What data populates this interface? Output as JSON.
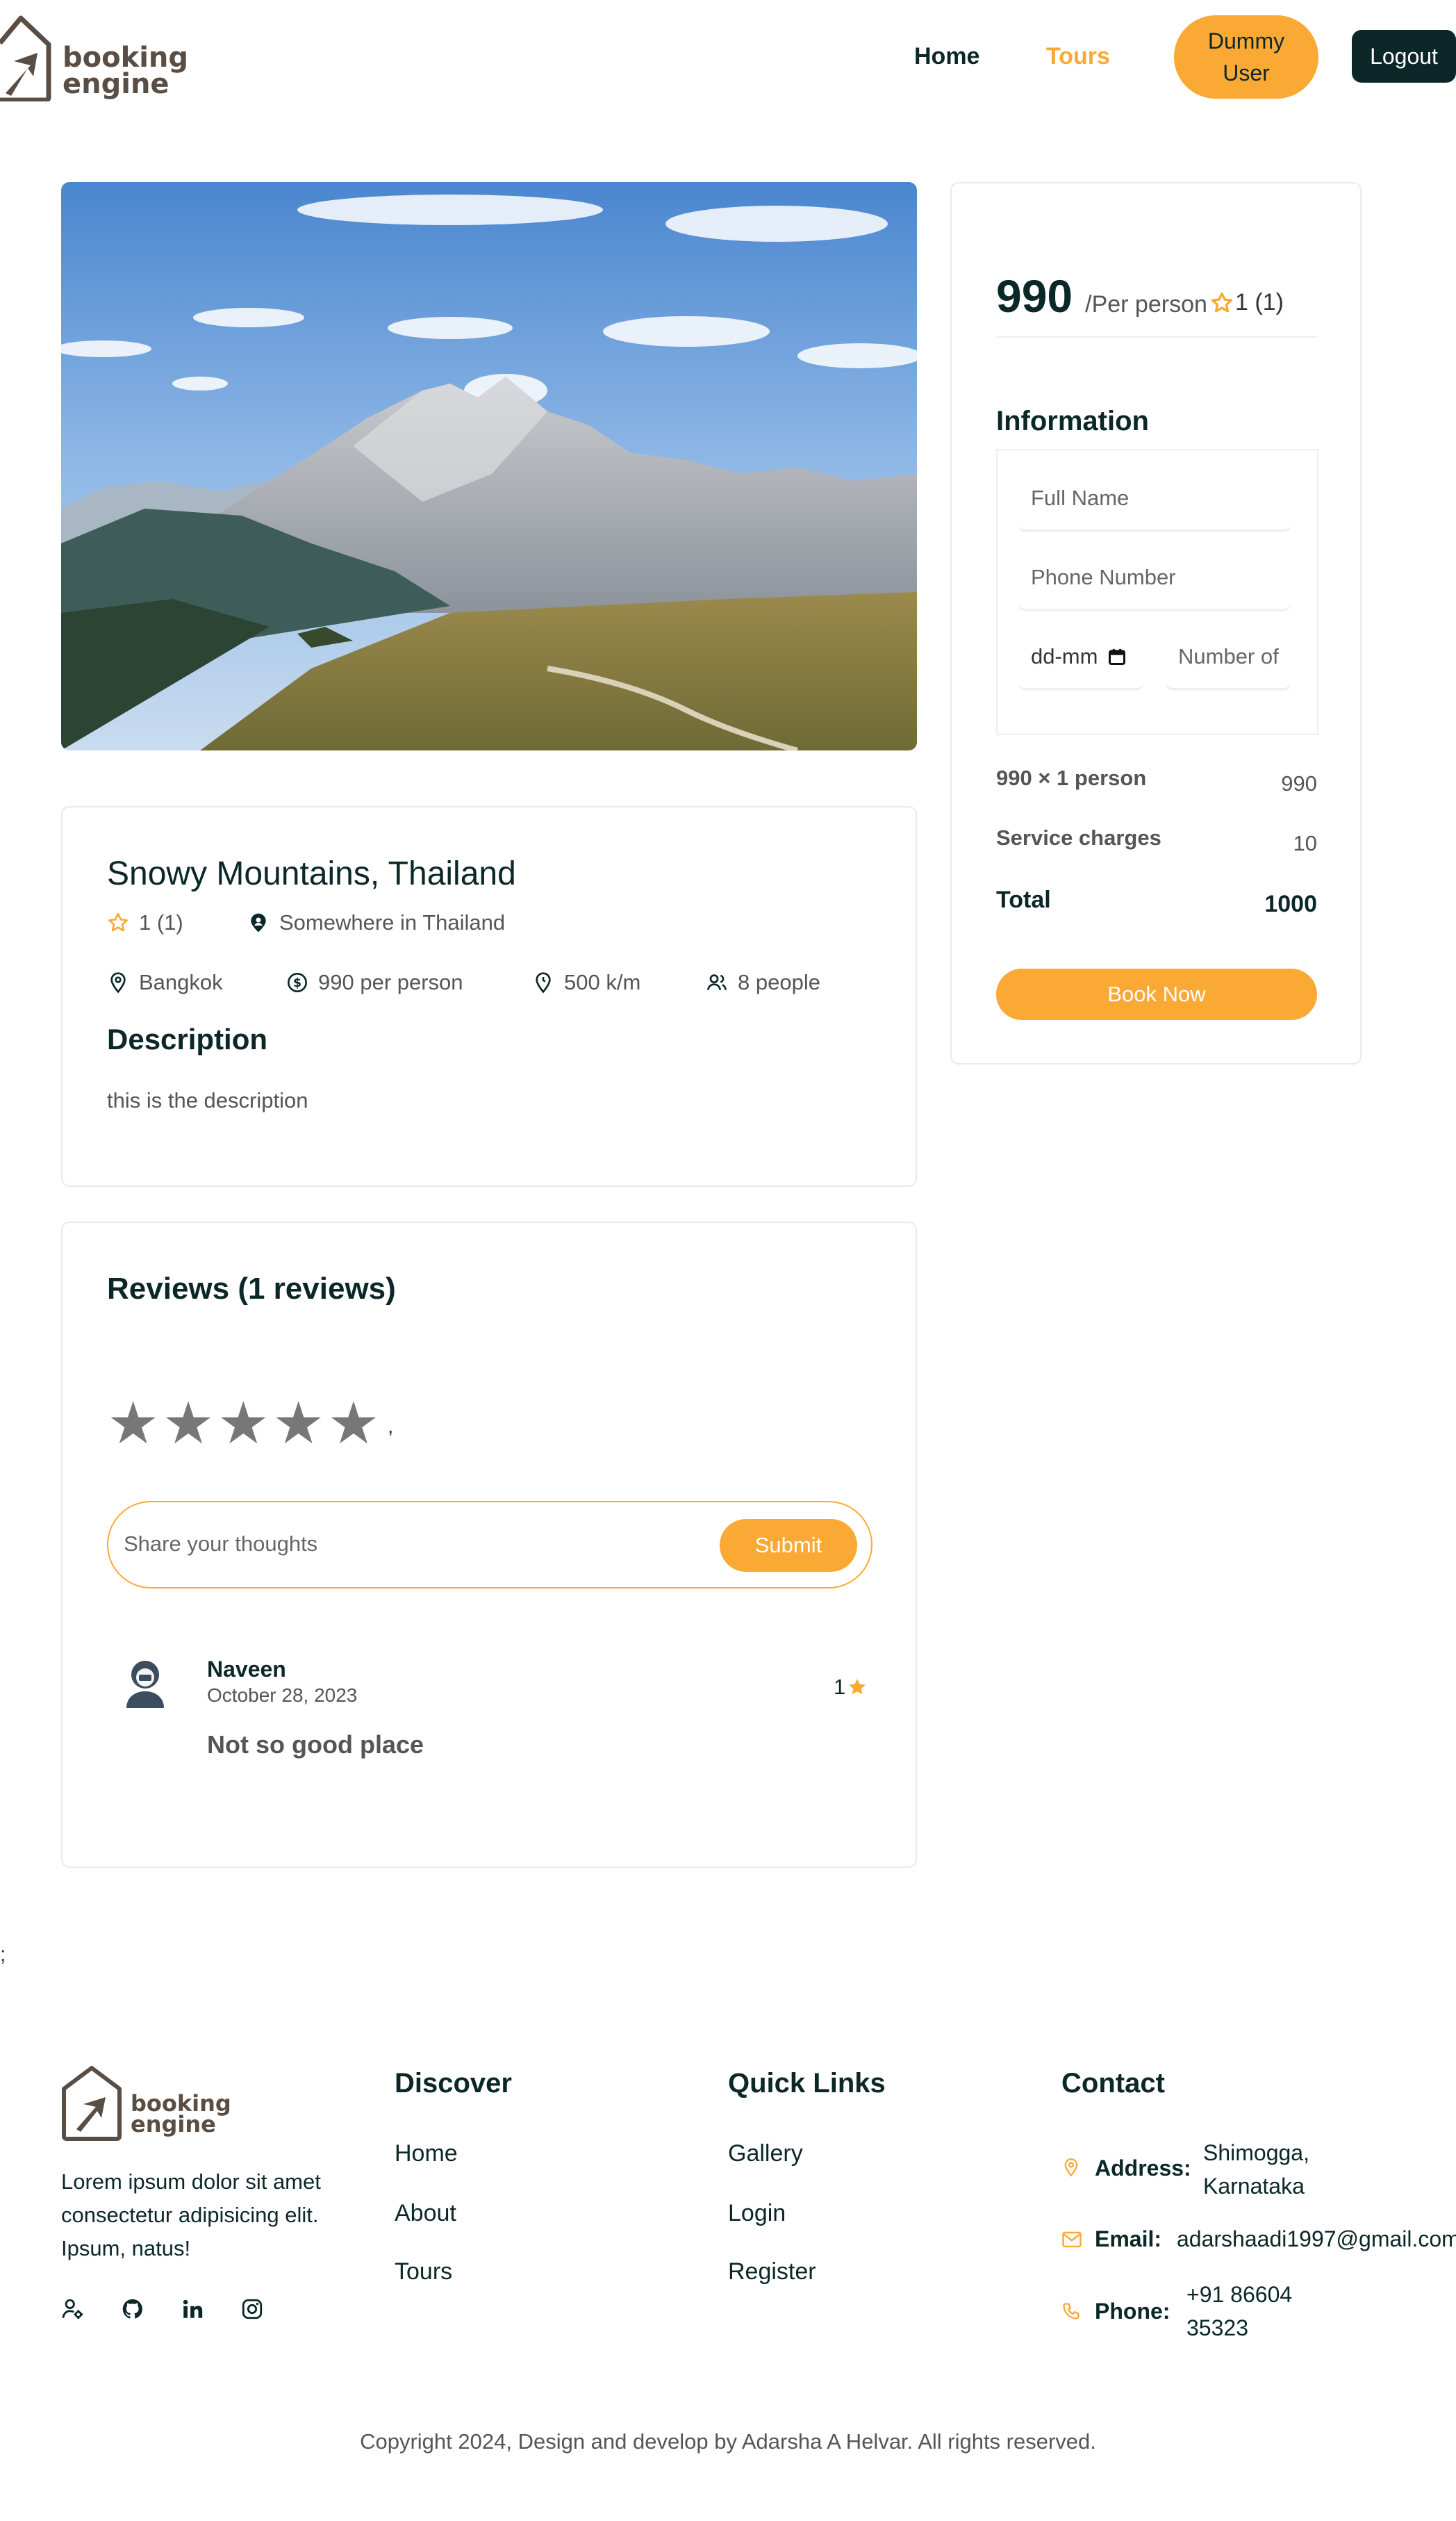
{
  "brand": {
    "line1": "booking",
    "line2": "engine"
  },
  "nav": {
    "home": "Home",
    "tours": "Tours",
    "user_line1": "Dummy",
    "user_line2": "User",
    "logout": "Logout"
  },
  "tour": {
    "title": "Snowy Mountains, Thailand",
    "rating": "1 (1)",
    "address": "Somewhere in Thailand",
    "city": "Bangkok",
    "price_text": "990 per person",
    "distance": "500 k/m",
    "group_size": "8 people",
    "description_heading": "Description",
    "description": "this is the description"
  },
  "reviews": {
    "heading": "Reviews (1 reviews)",
    "stars": [
      "★",
      "★",
      "★",
      "★",
      "★"
    ],
    "comma": ",",
    "input_placeholder": "Share your thoughts",
    "submit": "Submit",
    "items": [
      {
        "name": "Naveen",
        "date": "October 28, 2023",
        "rating": "1",
        "text": "Not so good place"
      }
    ]
  },
  "booking": {
    "price": "990",
    "per_person": "/Per person",
    "rating": "1 (1)",
    "info_heading": "Information",
    "full_name_placeholder": "Full Name",
    "phone_placeholder": "Phone Number",
    "date_placeholder": "dd-mm",
    "guests_placeholder": "Number of",
    "calc_label": "990 × 1 person",
    "calc_value": "990",
    "service_label": "Service charges",
    "service_value": "10",
    "total_label": "Total",
    "total_value": "1000",
    "book_button": "Book Now"
  },
  "stray_semicolon": ";",
  "footer": {
    "about": "Lorem ipsum dolor sit amet consectetur adipisicing elit. Ipsum, natus!",
    "discover_heading": "Discover",
    "discover_links": [
      "Home",
      "About",
      "Tours"
    ],
    "quick_heading": "Quick Links",
    "quick_links": [
      "Gallery",
      "Login",
      "Register"
    ],
    "contact_heading": "Contact",
    "address_label": "Address:",
    "address_line1": "Shimogga,",
    "address_line2": "Karnataka",
    "email_label": "Email:",
    "email": "adarshaadi1997@gmail.com",
    "phone_label": "Phone:",
    "phone_line1": "+91 86604",
    "phone_line2": "35323",
    "copyright": "Copyright 2024, Design and develop by Adarsha A Helvar. All rights reserved."
  },
  "colors": {
    "accent": "#faa935",
    "heading": "#0b2727",
    "brand": "#5a4d43"
  }
}
